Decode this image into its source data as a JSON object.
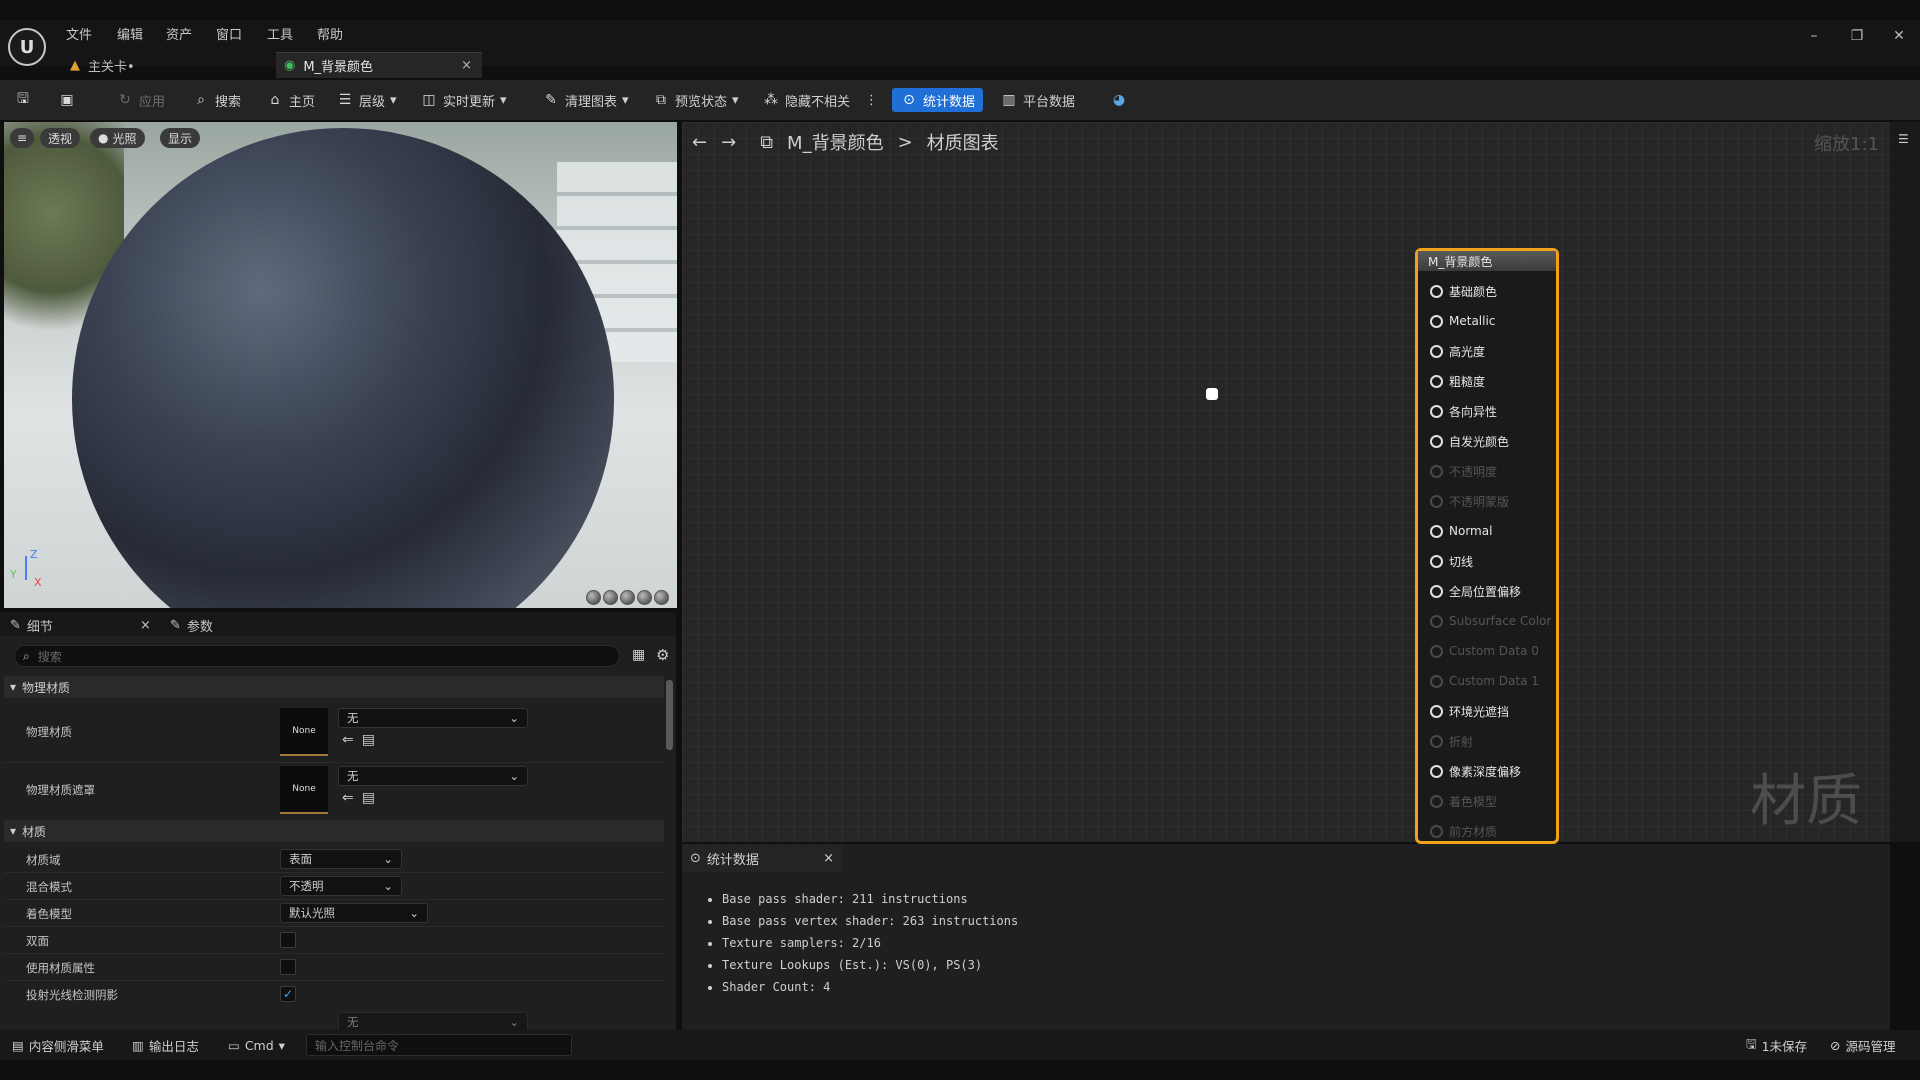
{
  "menu": [
    "文件",
    "编辑",
    "资产",
    "窗口",
    "工具",
    "帮助"
  ],
  "tabs": {
    "main": "主关卡•",
    "material": "M_背景颜色",
    "close": "×"
  },
  "toolbar": {
    "apply": "应用",
    "search": "搜索",
    "home": "主页",
    "hierarchy": "层级",
    "live_update": "实时更新",
    "clean_graph": "清理图表",
    "preview_state": "预览状态",
    "hide_unrelated": "隐藏不相关",
    "stats": "统计数据",
    "platform_stats": "平台数据"
  },
  "viewport": {
    "perspective": "透视",
    "lit": "光照",
    "show": "显示",
    "axis_z": "Z",
    "axis_x": "X",
    "axis_y": "Y"
  },
  "details": {
    "tab_details": "细节",
    "tab_params": "参数",
    "search_placeholder": "搜索",
    "section_physical": "物理材质",
    "phys_material_label": "物理材质",
    "phys_mask_label": "物理材质遮罩",
    "none": "None",
    "combo_none": "无",
    "section_material": "材质",
    "domain_label": "材质域",
    "domain_value": "表面",
    "blend_label": "混合模式",
    "blend_value": "不透明",
    "shading_label": "着色模型",
    "shading_value": "默认光照",
    "two_sided_label": "双面",
    "use_attr_label": "使用材质属性",
    "raytrace_label": "投射光线检测阴影",
    "raytrace_checked": "✓"
  },
  "graph": {
    "breadcrumb_material": "M_背景颜色",
    "breadcrumb_sep": ">",
    "breadcrumb_graph": "材质图表",
    "zoom": "缩放1:1",
    "watermark": "材质",
    "node_title": "M_背景颜色",
    "pins": [
      {
        "label": "基础颜色",
        "enabled": true
      },
      {
        "label": "Metallic",
        "enabled": true
      },
      {
        "label": "高光度",
        "enabled": true
      },
      {
        "label": "粗糙度",
        "enabled": true
      },
      {
        "label": "各向异性",
        "enabled": true
      },
      {
        "label": "自发光颜色",
        "enabled": true
      },
      {
        "label": "不透明度",
        "enabled": false
      },
      {
        "label": "不透明蒙版",
        "enabled": false
      },
      {
        "label": "Normal",
        "enabled": true
      },
      {
        "label": "切线",
        "enabled": true
      },
      {
        "label": "全局位置偏移",
        "enabled": true
      },
      {
        "label": "Subsurface Color",
        "enabled": false
      },
      {
        "label": "Custom Data 0",
        "enabled": false
      },
      {
        "label": "Custom Data 1",
        "enabled": false
      },
      {
        "label": "环境光遮挡",
        "enabled": true
      },
      {
        "label": "折射",
        "enabled": false
      },
      {
        "label": "像素深度偏移",
        "enabled": true
      },
      {
        "label": "着色模型",
        "enabled": false
      },
      {
        "label": "前方材质",
        "enabled": false
      }
    ]
  },
  "stats": {
    "tab": "统计数据",
    "lines": [
      "Base pass shader: 211 instructions",
      "Base pass vertex shader: 263 instructions",
      "Texture samplers: 2/16",
      "Texture Lookups (Est.): VS(0), PS(3)",
      "Shader Count: 4"
    ]
  },
  "statusbar": {
    "content_drawer": "内容侧滑菜单",
    "output_log": "输出日志",
    "cmd": "Cmd",
    "cmd_placeholder": "输入控制台命令",
    "unsaved": "1未保存",
    "source_control": "源码管理"
  },
  "colors": {
    "accent": "#1f6fd6",
    "node_border": "#f0a21a"
  }
}
